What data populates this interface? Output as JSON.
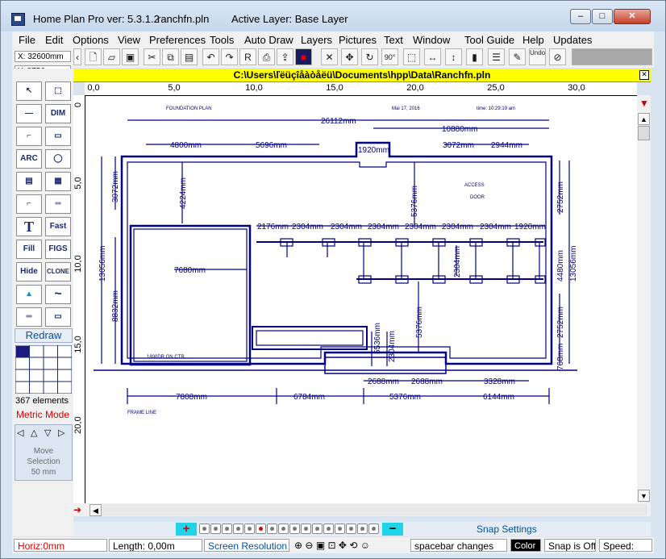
{
  "window": {
    "app_title": "Home Plan Pro ver: 5.3.1.2",
    "file_name": "ranchfn.pln",
    "active_layer": "Active Layer: Base Layer",
    "minimize_label": "–",
    "maximize_label": "□",
    "close_label": "✕"
  },
  "menu": [
    "File",
    "Edit",
    "Options",
    "View",
    "Preferences",
    "Tools",
    "Auto Draw",
    "Layers",
    "Pictures",
    "Text",
    "Window",
    "Tool Guide",
    "Help",
    "Updates"
  ],
  "toolbar": {
    "undo_label": "Undo",
    "icons": [
      "panel-toggle",
      "new-file",
      "open-file",
      "save-file",
      "cut",
      "copy",
      "paste",
      "undo",
      "redo",
      "print-preview",
      "print",
      "export",
      "color",
      "delete",
      "move",
      "rotate",
      "rotate-90",
      "select-area",
      "flip-horizontal",
      "flip-vertical",
      "fill",
      "grid-lines",
      "undo-all",
      "snap-lock"
    ]
  },
  "coords": {
    "x": "X: 32600mm",
    "y": "Y: 8750mm"
  },
  "path": "C:\\Users\\ľëüçîåàòåëü\\Documents\\hpp\\Data\\Ranchfn.pln",
  "ruler": {
    "horizontal": [
      "0,0",
      "5,0",
      "10,0",
      "15,0",
      "20,0",
      "25,0",
      "30,0"
    ],
    "vertical": [
      "0",
      "5,0",
      "10,0",
      "15,0",
      "20,0"
    ]
  },
  "left_panel": {
    "tools": [
      {
        "label": "↖",
        "name": "select-pointer-tool"
      },
      {
        "label": "⬚",
        "name": "select-box-tool"
      },
      {
        "label": "—",
        "name": "line-tool"
      },
      {
        "label": "DIM",
        "name": "dimension-tool"
      },
      {
        "label": "⌐",
        "name": "wall-tool"
      },
      {
        "label": "▭",
        "name": "rectangle-tool"
      },
      {
        "label": "ARC",
        "name": "arc-tool"
      },
      {
        "label": "◯",
        "name": "circle-tool"
      },
      {
        "label": "▤",
        "name": "window-tool"
      },
      {
        "label": "▦",
        "name": "grid-tool"
      },
      {
        "label": "⌐",
        "name": "stairs-tool"
      },
      {
        "label": "═",
        "name": "double-line-tool"
      },
      {
        "label": "T",
        "name": "text-tool"
      },
      {
        "label": "Fast",
        "name": "fast-text-tool"
      },
      {
        "label": "Fill",
        "name": "fill-tool"
      },
      {
        "label": "FIGS",
        "name": "figures-tool"
      },
      {
        "label": "Hide",
        "name": "hide-tool"
      },
      {
        "label": "CLONE",
        "name": "clone-tool"
      },
      {
        "label": "▲",
        "name": "picture-tool"
      },
      {
        "label": "~",
        "name": "curve-tool"
      },
      {
        "label": "═",
        "name": "dual-line-tool"
      },
      {
        "label": "▭",
        "name": "frame-tool"
      }
    ],
    "redraw": "Redraw",
    "elements": "367 elements",
    "metric_mode": "Metric Mode",
    "move_selection": "Move\nSelection\n50 mm"
  },
  "plan": {
    "header_left": "FOUNDATION PLAN",
    "header_date": "Mai 17, 2016",
    "header_time": "time: 10:29:19 am",
    "access_door_1": "ACCESS",
    "access_door_2": "DOOR",
    "room_note": "1800DR ON CTR.",
    "frame_line": "FRAME LINE",
    "dims": {
      "top_total": "26112mm",
      "top_right": "10880mm",
      "top_1": "4800mm",
      "top_2": "5696mm",
      "top_3": "1920mm",
      "top_4": "3072mm",
      "top_5": "2944mm",
      "row_1": "2176mm",
      "row_2": "2304mm",
      "row_3": "2304mm",
      "row_4": "2304mm",
      "row_5": "2304mm",
      "row_6": "2304mm",
      "row_7": "2304mm",
      "row_8": "1920mm",
      "left_outer": "13056mm",
      "left_upper": "3072mm",
      "left_inner": "8832mm",
      "inner_vert": "4224mm",
      "room_width": "7680mm",
      "mid_vert_1": "5376mm",
      "mid_vert_2": "5376mm",
      "mid_vert_3": "2304mm",
      "mid_vert_4": "5536mm",
      "mid_vert_5": "2304mm",
      "right_1": "2752mm",
      "right_2": "4480mm",
      "right_3": "2752mm",
      "right_4": "768mm",
      "right_outer": "13056mm",
      "bot_1": "2688mm",
      "bot_2": "2688mm",
      "bot_3": "3328mm",
      "bottom_1": "7808mm",
      "bottom_2": "6784mm",
      "bottom_3": "5376mm",
      "bottom_4": "6144mm"
    }
  },
  "layer_bar": {
    "add": "+",
    "remove": "−",
    "count": 16,
    "active_index": 5
  },
  "status": {
    "horiz": "Horiz:0mm",
    "length": "Length: 0,00m",
    "screen_resolution": "Screen Resolution",
    "spacebar": "spacebar changes",
    "color": "Color",
    "snap": "Snap is Off",
    "speed": "Speed:",
    "snap_settings": "Snap Settings"
  },
  "colors": {
    "accent_yellow": "#ffff00",
    "plan_ink": "#000080",
    "metric_red": "#e00000",
    "layer_cyan": "#1fd4e8",
    "redraw_blue": "#0050a0"
  }
}
